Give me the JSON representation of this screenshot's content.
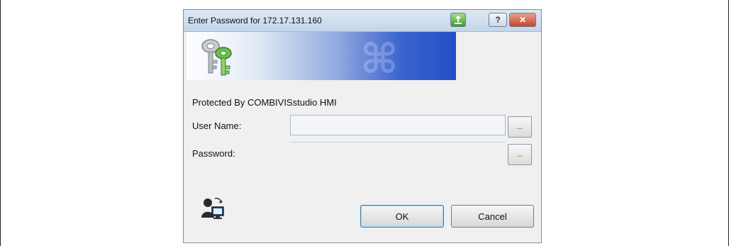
{
  "dialog": {
    "title": "Enter Password for 172.17.131.160",
    "titlebar_icons": [
      "green-arrow-icon",
      "help-icon",
      "close-icon"
    ],
    "help_label": "?",
    "close_label": "✕",
    "banner_icons": [
      "keys-icon"
    ],
    "protected_label": "Protected By COMBIVISstudio HMI",
    "user_name_label": "User Name:",
    "user_name_value": "",
    "password_label": "Password:",
    "password_value": "",
    "browse_label": "...",
    "ok_label": "OK",
    "cancel_label": "Cancel",
    "footer_icon": "user-computer-icon"
  },
  "colors": {
    "banner_blue": "#2350c8",
    "ok_border": "#3c7fb1",
    "close_red": "#c6452a"
  }
}
